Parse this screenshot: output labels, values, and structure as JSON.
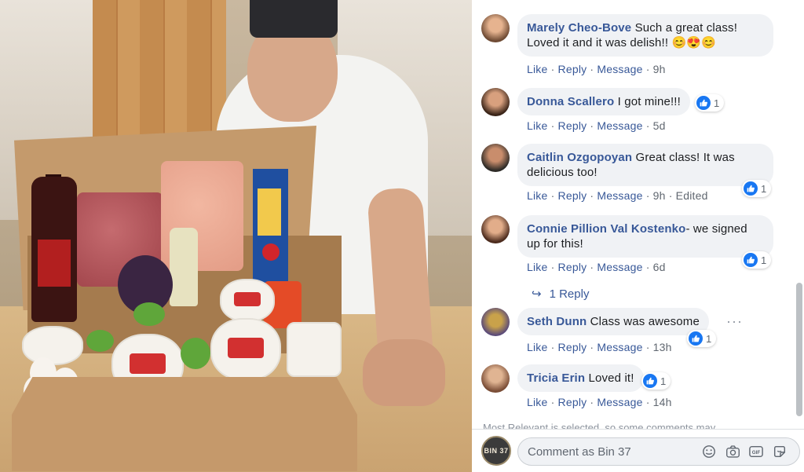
{
  "photo": {
    "alt": ""
  },
  "comments": [
    {
      "name": "Marely Cheo-Bove",
      "text": "Such a great class! Loved it and it was delish!! 😊😍😊",
      "actions": {
        "like": "Like",
        "reply": "Reply",
        "message": "Message",
        "time": "9h"
      }
    },
    {
      "name": "Donna Scallero",
      "text": "I got mine!!!",
      "reactions": "1",
      "actions": {
        "like": "Like",
        "reply": "Reply",
        "message": "Message",
        "time": "5d"
      }
    },
    {
      "name": "Caitlin Ozgopoyan",
      "text": "Great class! It was delicious too!",
      "reactions": "1",
      "actions": {
        "like": "Like",
        "reply": "Reply",
        "message": "Message",
        "time": "9h",
        "edited": "Edited"
      }
    },
    {
      "name": "Connie Pillion",
      "mention": "Val Kostenko",
      "text": "- we signed up for this!",
      "reactions": "1",
      "actions": {
        "like": "Like",
        "reply": "Reply",
        "message": "Message",
        "time": "6d"
      },
      "replies": "1 Reply"
    },
    {
      "name": "Seth Dunn",
      "text": "Class was awesome",
      "reactions": "1",
      "actions": {
        "like": "Like",
        "reply": "Reply",
        "message": "Message",
        "time": "13h"
      }
    },
    {
      "name": "Tricia Erin",
      "text": "Loved it!",
      "reactions": "1",
      "actions": {
        "like": "Like",
        "reply": "Reply",
        "message": "Message",
        "time": "14h"
      }
    }
  ],
  "notice": "Most Relevant is selected, so some comments may",
  "composer": {
    "avatar_text": "BIN 37",
    "placeholder": "Comment as Bin 37"
  },
  "icons": [
    "emoji-icon",
    "camera-icon",
    "gif-icon",
    "sticker-icon",
    "like-icon",
    "reply-arrow-icon",
    "more-options-icon"
  ],
  "colors": {
    "link": "#385898",
    "bubble": "#f0f2f5",
    "like_blue": "#1877f2",
    "muted": "#606770"
  }
}
